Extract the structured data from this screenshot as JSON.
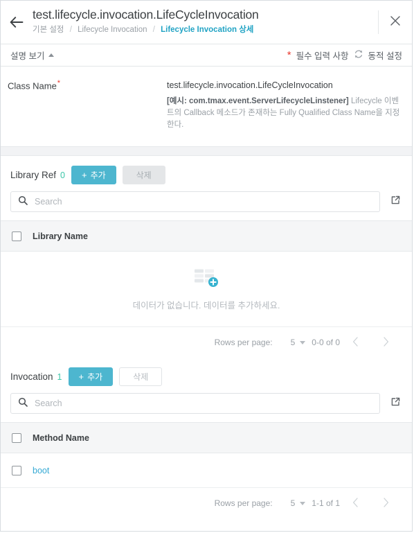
{
  "header": {
    "back_icon": "arrow-left-icon",
    "title": "test.lifecycle.invocation.LifeCycleInvocation",
    "breadcrumbs": [
      {
        "label": "기본 설정",
        "active": false
      },
      {
        "label": "Lifecycle Invocation",
        "active": false
      },
      {
        "label": "Lifecycle Invocation 상세",
        "active": true
      }
    ],
    "separator": "/",
    "close_icon": "close-icon"
  },
  "subbar": {
    "description_toggle_label": "설명 보기",
    "description_toggle_icon": "chevron-up-icon",
    "required_star": "*",
    "required_label": "필수 입력 사항",
    "dynamic_icon": "refresh-icon",
    "dynamic_label": "동적 설정"
  },
  "field": {
    "label": "Class Name",
    "required_marker": "*",
    "value": "test.lifecycle.invocation.LifeCycleInvocation",
    "help_bold": "[예시: com.tmax.event.ServerLifecycleLinstener]",
    "help_rest": " Lifecycle 이벤트의 Callback 메소드가 존재하는 Fully Qualified Class Name을 지정한다."
  },
  "library_ref": {
    "title": "Library Ref",
    "count": "0",
    "add_label": "추가",
    "add_plus": "+",
    "delete_label": "삭제",
    "search_placeholder": "Search",
    "search_value": "",
    "search_icon": "search-icon",
    "expand_icon": "external-link-icon",
    "column_header": "Library Name",
    "rows": [],
    "empty_message": "데이터가 없습니다. 데이터를 추가하세요.",
    "empty_icon": "table-add-icon",
    "pager": {
      "rows_per_page_label": "Rows per page:",
      "rows_per_page_value": "5",
      "range": "0-0 of 0",
      "prev_icon": "chevron-left-icon",
      "next_icon": "chevron-right-icon"
    }
  },
  "invocation": {
    "title": "Invocation",
    "count": "1",
    "add_label": "추가",
    "add_plus": "+",
    "delete_label": "삭제",
    "search_placeholder": "Search",
    "search_value": "",
    "search_icon": "search-icon",
    "expand_icon": "external-link-icon",
    "column_header": "Method Name",
    "rows": [
      {
        "method_name": "boot"
      }
    ],
    "pager": {
      "rows_per_page_label": "Rows per page:",
      "rows_per_page_value": "5",
      "range": "1-1 of 1",
      "prev_icon": "chevron-left-icon",
      "next_icon": "chevron-right-icon"
    }
  },
  "colors": {
    "accent": "#4db6cf",
    "link": "#35a9d4",
    "count": "#3cc6a8",
    "required": "#e8392e",
    "muted": "#9aa0a6"
  }
}
